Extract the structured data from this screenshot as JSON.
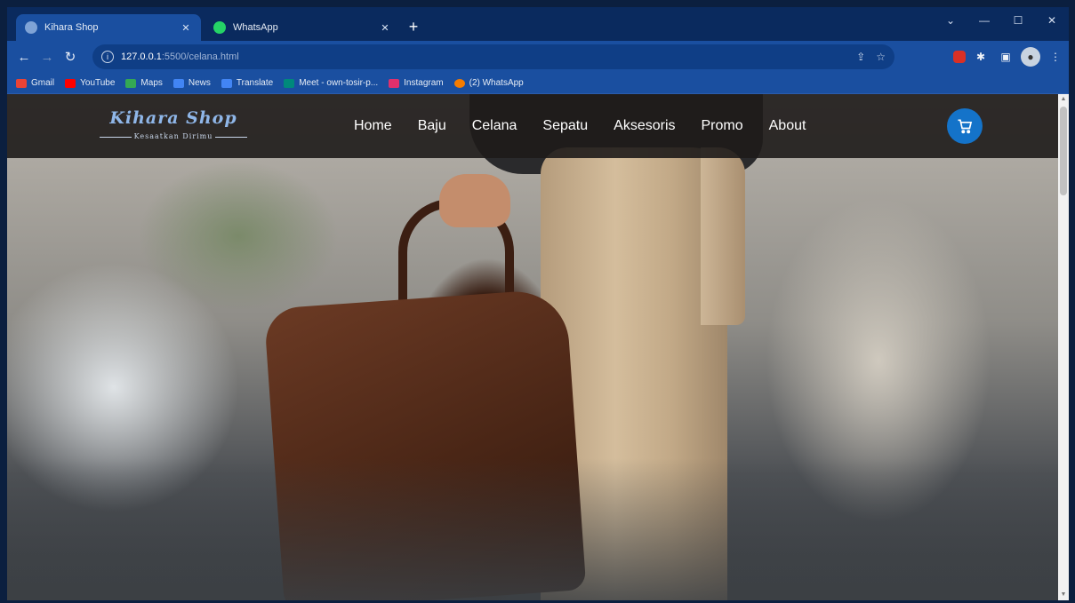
{
  "browser": {
    "tabs": [
      {
        "label": "Kihara Shop",
        "active": true
      },
      {
        "label": "WhatsApp",
        "active": false
      }
    ],
    "new_tab_symbol": "+",
    "window_controls": [
      "chevron-down-icon",
      "minimize-icon",
      "restore-icon",
      "close-icon"
    ],
    "address": {
      "host": "127.0.0.1",
      "rest": ":5500/celana.html"
    },
    "bookmarks": [
      {
        "label": "Gmail",
        "color": "#ea4335"
      },
      {
        "label": "YouTube",
        "color": "#ff0000"
      },
      {
        "label": "Maps",
        "color": "#34a853"
      },
      {
        "label": "News",
        "color": "#4285f4"
      },
      {
        "label": "Translate",
        "color": "#4285f4"
      },
      {
        "label": "Meet - own-tosir-p...",
        "color": "#00897b"
      },
      {
        "label": "Instagram",
        "color": "#e1306c"
      },
      {
        "label": "(2) WhatsApp",
        "color": "#f57c00"
      }
    ]
  },
  "site": {
    "logo": {
      "main": "Kihara Shop",
      "sub": "Kesaatkan Dirimu"
    },
    "nav": [
      "Home",
      "Baju",
      "Celana",
      "Sepatu",
      "Aksesoris",
      "Promo",
      "About"
    ],
    "cart_icon": "cart-icon",
    "accent_color": "#1473c9"
  }
}
